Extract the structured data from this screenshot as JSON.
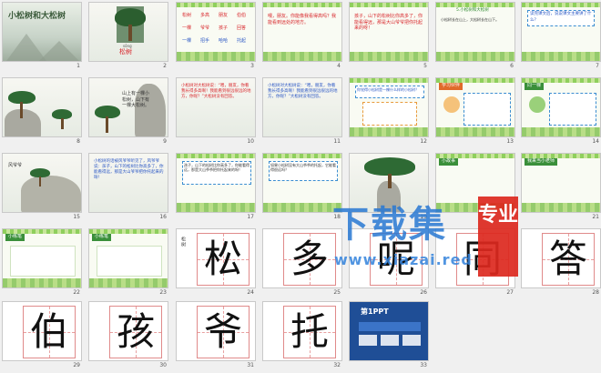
{
  "slides": [
    {
      "number": "1",
      "title": "小松树和大松树"
    },
    {
      "number": "2",
      "caption_pinyin": "sōng",
      "caption": "松树"
    },
    {
      "number": "3",
      "words": [
        "松树",
        "多高",
        "朋友",
        "伯伯",
        "一棵",
        "爷爷",
        "孩子",
        "回答",
        "一棵",
        "招手",
        "哈哈",
        "托起"
      ]
    },
    {
      "number": "4",
      "text": "喂，朋友。你能像我看得高吗？我能看到远处的地方。"
    },
    {
      "number": "5",
      "text": "孩子，山下的松树比你高多了，你能看得远，那是大山爷爷把你托起来的呀！"
    },
    {
      "number": "6",
      "title": "5.小松树和大松树",
      "text": "小松树长在山上，大松树长在山下。"
    },
    {
      "number": "7",
      "text": "读完课文后，说说课文主要讲了什么？"
    },
    {
      "number": "8"
    },
    {
      "number": "9",
      "text": "山上有一棵小松树，山下有一棵大松树。"
    },
    {
      "number": "10",
      "text": "小松树对大松树说：“喂，朋友，你看我长得多高啊！我能看到很远很远的地方，你呢？”大松树没有回答。"
    },
    {
      "number": "11",
      "text": "小松树对大松树说：“喂，朋友，你看我长得多高啊！我能看到很远很远的地方，你呢？”大松树没有回答。"
    },
    {
      "number": "12",
      "text": "你觉得小松树是一棵什么样的小松树？"
    },
    {
      "number": "13",
      "label": "学习伙伴"
    },
    {
      "number": "14",
      "label": "同一棵"
    },
    {
      "number": "15",
      "text": "风爷爷"
    },
    {
      "number": "16",
      "text": "小松树的话被风爷爷听见了，风爷爷说：孩子，山下的松树比你高多了，你能看得远，那是大山爷爷把你托起来的呀！"
    },
    {
      "number": "17",
      "text": "孩子，山下的松树比你高多了，你能看得远，那是大山爷爷把你托起来的呀！"
    },
    {
      "number": "18",
      "text": "如果小松树没有大山爷爷的托起，它能看得很远吗？"
    },
    {
      "number": "19"
    },
    {
      "number": "20",
      "label": "小故事"
    },
    {
      "number": "21",
      "label": "我来当小老师"
    },
    {
      "number": "22",
      "label": "小练笔"
    },
    {
      "number": "23",
      "label": "小练笔"
    },
    {
      "number": "24",
      "char": "松"
    },
    {
      "number": "25",
      "char": "多"
    },
    {
      "number": "26",
      "char": "呢"
    },
    {
      "number": "27",
      "char": "同"
    },
    {
      "number": "28",
      "char": "答"
    },
    {
      "number": "29",
      "char": "伯"
    },
    {
      "number": "30",
      "char": "孩"
    },
    {
      "number": "31",
      "char": "爷"
    },
    {
      "number": "32",
      "char": "托"
    },
    {
      "number": "33",
      "brand": "第1PPT"
    }
  ],
  "watermark": {
    "title": "下载集",
    "badge": "专业",
    "url": "www.xiazai.red"
  },
  "colors": {
    "accent_red": "#d8262b",
    "accent_blue": "#2a56c4",
    "watermark_blue": "#2878d2"
  }
}
